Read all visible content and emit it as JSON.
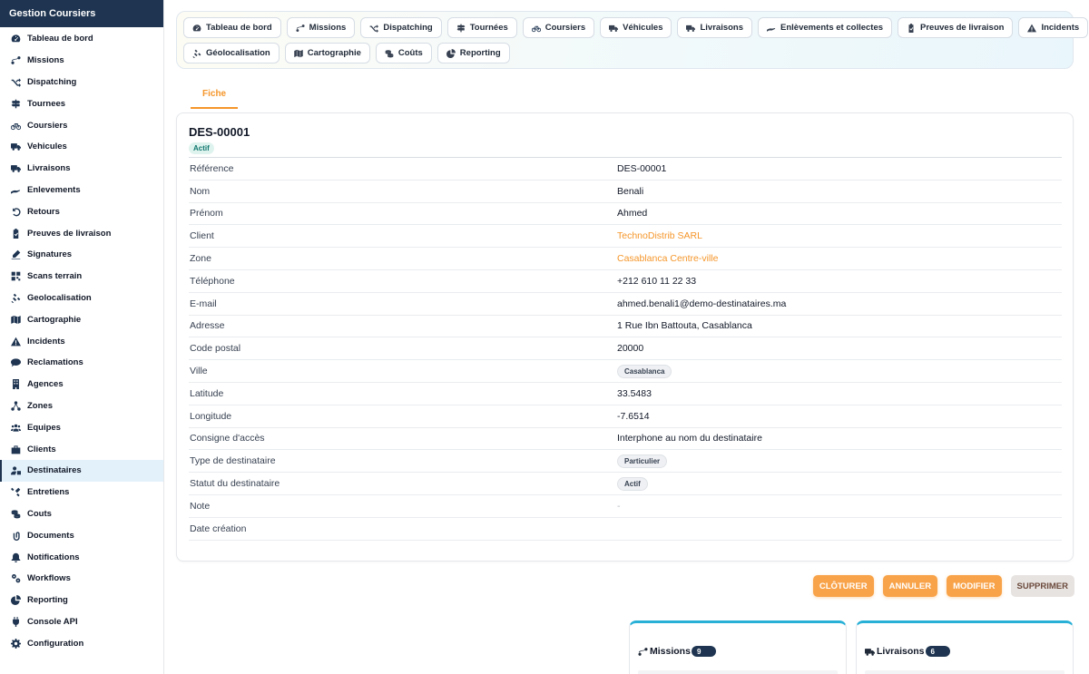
{
  "sidebar": {
    "title": "Gestion Coursiers",
    "items": [
      {
        "label": "Tableau de bord",
        "icon": "dashboard-icon"
      },
      {
        "label": "Missions",
        "icon": "route-icon"
      },
      {
        "label": "Dispatching",
        "icon": "shuffle-icon"
      },
      {
        "label": "Tournees",
        "icon": "signpost-icon"
      },
      {
        "label": "Coursiers",
        "icon": "bicycle-icon"
      },
      {
        "label": "Vehicules",
        "icon": "truck-icon"
      },
      {
        "label": "Livraisons",
        "icon": "delivery-truck-icon"
      },
      {
        "label": "Enlevements",
        "icon": "hand-holding-icon"
      },
      {
        "label": "Retours",
        "icon": "undo-icon"
      },
      {
        "label": "Preuves de livraison",
        "icon": "clipboard-check-icon"
      },
      {
        "label": "Signatures",
        "icon": "signature-icon"
      },
      {
        "label": "Scans terrain",
        "icon": "qrcode-icon"
      },
      {
        "label": "Geolocalisation",
        "icon": "satellite-icon"
      },
      {
        "label": "Cartographie",
        "icon": "map-icon"
      },
      {
        "label": "Incidents",
        "icon": "warning-icon"
      },
      {
        "label": "Reclamations",
        "icon": "comment-icon"
      },
      {
        "label": "Agences",
        "icon": "building-icon"
      },
      {
        "label": "Zones",
        "icon": "network-icon"
      },
      {
        "label": "Equipes",
        "icon": "users-icon"
      },
      {
        "label": "Clients",
        "icon": "briefcase-icon"
      },
      {
        "label": "Destinataires",
        "icon": "user-tag-icon"
      },
      {
        "label": "Entretiens",
        "icon": "tools-icon"
      },
      {
        "label": "Couts",
        "icon": "coins-icon"
      },
      {
        "label": "Documents",
        "icon": "paperclip-icon"
      },
      {
        "label": "Notifications",
        "icon": "bell-icon"
      },
      {
        "label": "Workflows",
        "icon": "cogs-icon"
      },
      {
        "label": "Reporting",
        "icon": "pie-chart-icon"
      },
      {
        "label": "Console API",
        "icon": "plug-icon"
      },
      {
        "label": "Configuration",
        "icon": "gear-icon"
      }
    ],
    "active_index": 20
  },
  "module_nav": {
    "row1": [
      {
        "label": "Tableau de bord",
        "icon": "dashboard-icon"
      },
      {
        "label": "Missions",
        "icon": "route-icon"
      },
      {
        "label": "Dispatching",
        "icon": "shuffle-icon"
      },
      {
        "label": "Tournées",
        "icon": "signpost-icon"
      },
      {
        "label": "Coursiers",
        "icon": "bicycle-icon"
      },
      {
        "label": "Véhicules",
        "icon": "truck-icon"
      },
      {
        "label": "Livraisons",
        "icon": "delivery-truck-icon"
      },
      {
        "label": "Enlèvements et collectes",
        "icon": "hand-holding-icon"
      },
      {
        "label": "Preuves de livraison",
        "icon": "clipboard-check-icon"
      },
      {
        "label": "Incidents",
        "icon": "warning-icon"
      }
    ],
    "row2": [
      {
        "label": "Géolocalisation",
        "icon": "satellite-icon"
      },
      {
        "label": "Cartographie",
        "icon": "map-icon"
      },
      {
        "label": "Coûts",
        "icon": "coins-icon"
      },
      {
        "label": "Reporting",
        "icon": "pie-chart-icon"
      }
    ]
  },
  "tab": {
    "label": "Fiche"
  },
  "record": {
    "id": "DES-00001",
    "status": "Actif",
    "fields": [
      {
        "label": "Référence",
        "value": "DES-00001",
        "kind": "text"
      },
      {
        "label": "Nom",
        "value": "Benali",
        "kind": "text"
      },
      {
        "label": "Prénom",
        "value": "Ahmed",
        "kind": "text"
      },
      {
        "label": "Client",
        "value": "TechnoDistrib SARL",
        "kind": "link"
      },
      {
        "label": "Zone",
        "value": "Casablanca Centre-ville",
        "kind": "link"
      },
      {
        "label": "Téléphone",
        "value": "+212 610 11 22 33",
        "kind": "text"
      },
      {
        "label": "E-mail",
        "value": "ahmed.benali1@demo-destinataires.ma",
        "kind": "text"
      },
      {
        "label": "Adresse",
        "value": "1 Rue Ibn Battouta, Casablanca",
        "kind": "text"
      },
      {
        "label": "Code postal",
        "value": "20000",
        "kind": "text"
      },
      {
        "label": "Ville",
        "value": "Casablanca",
        "kind": "pill"
      },
      {
        "label": "Latitude",
        "value": "33.5483",
        "kind": "text"
      },
      {
        "label": "Longitude",
        "value": "-7.6514",
        "kind": "text"
      },
      {
        "label": "Consigne d'accès",
        "value": "Interphone au nom du destinataire",
        "kind": "text"
      },
      {
        "label": "Type de destinataire",
        "value": "Particulier",
        "kind": "pill"
      },
      {
        "label": "Statut du destinataire",
        "value": "Actif",
        "kind": "pill"
      },
      {
        "label": "Note",
        "value": "-",
        "kind": "muted"
      },
      {
        "label": "Date création",
        "value": "",
        "kind": "text"
      }
    ]
  },
  "actions": {
    "close": "CLÔTURER",
    "cancel": "ANNULER",
    "edit": "MODIFIER",
    "delete": "SUPPRIMER"
  },
  "related": {
    "missions": {
      "label": "Missions",
      "count": "9"
    },
    "livraisons": {
      "label": "Livraisons",
      "count": "6"
    }
  },
  "colors": {
    "sidebar_header": "#1e3450",
    "accent": "#f5962a",
    "active_bg": "#e3f1fb",
    "related_border": "#28b0d6"
  }
}
